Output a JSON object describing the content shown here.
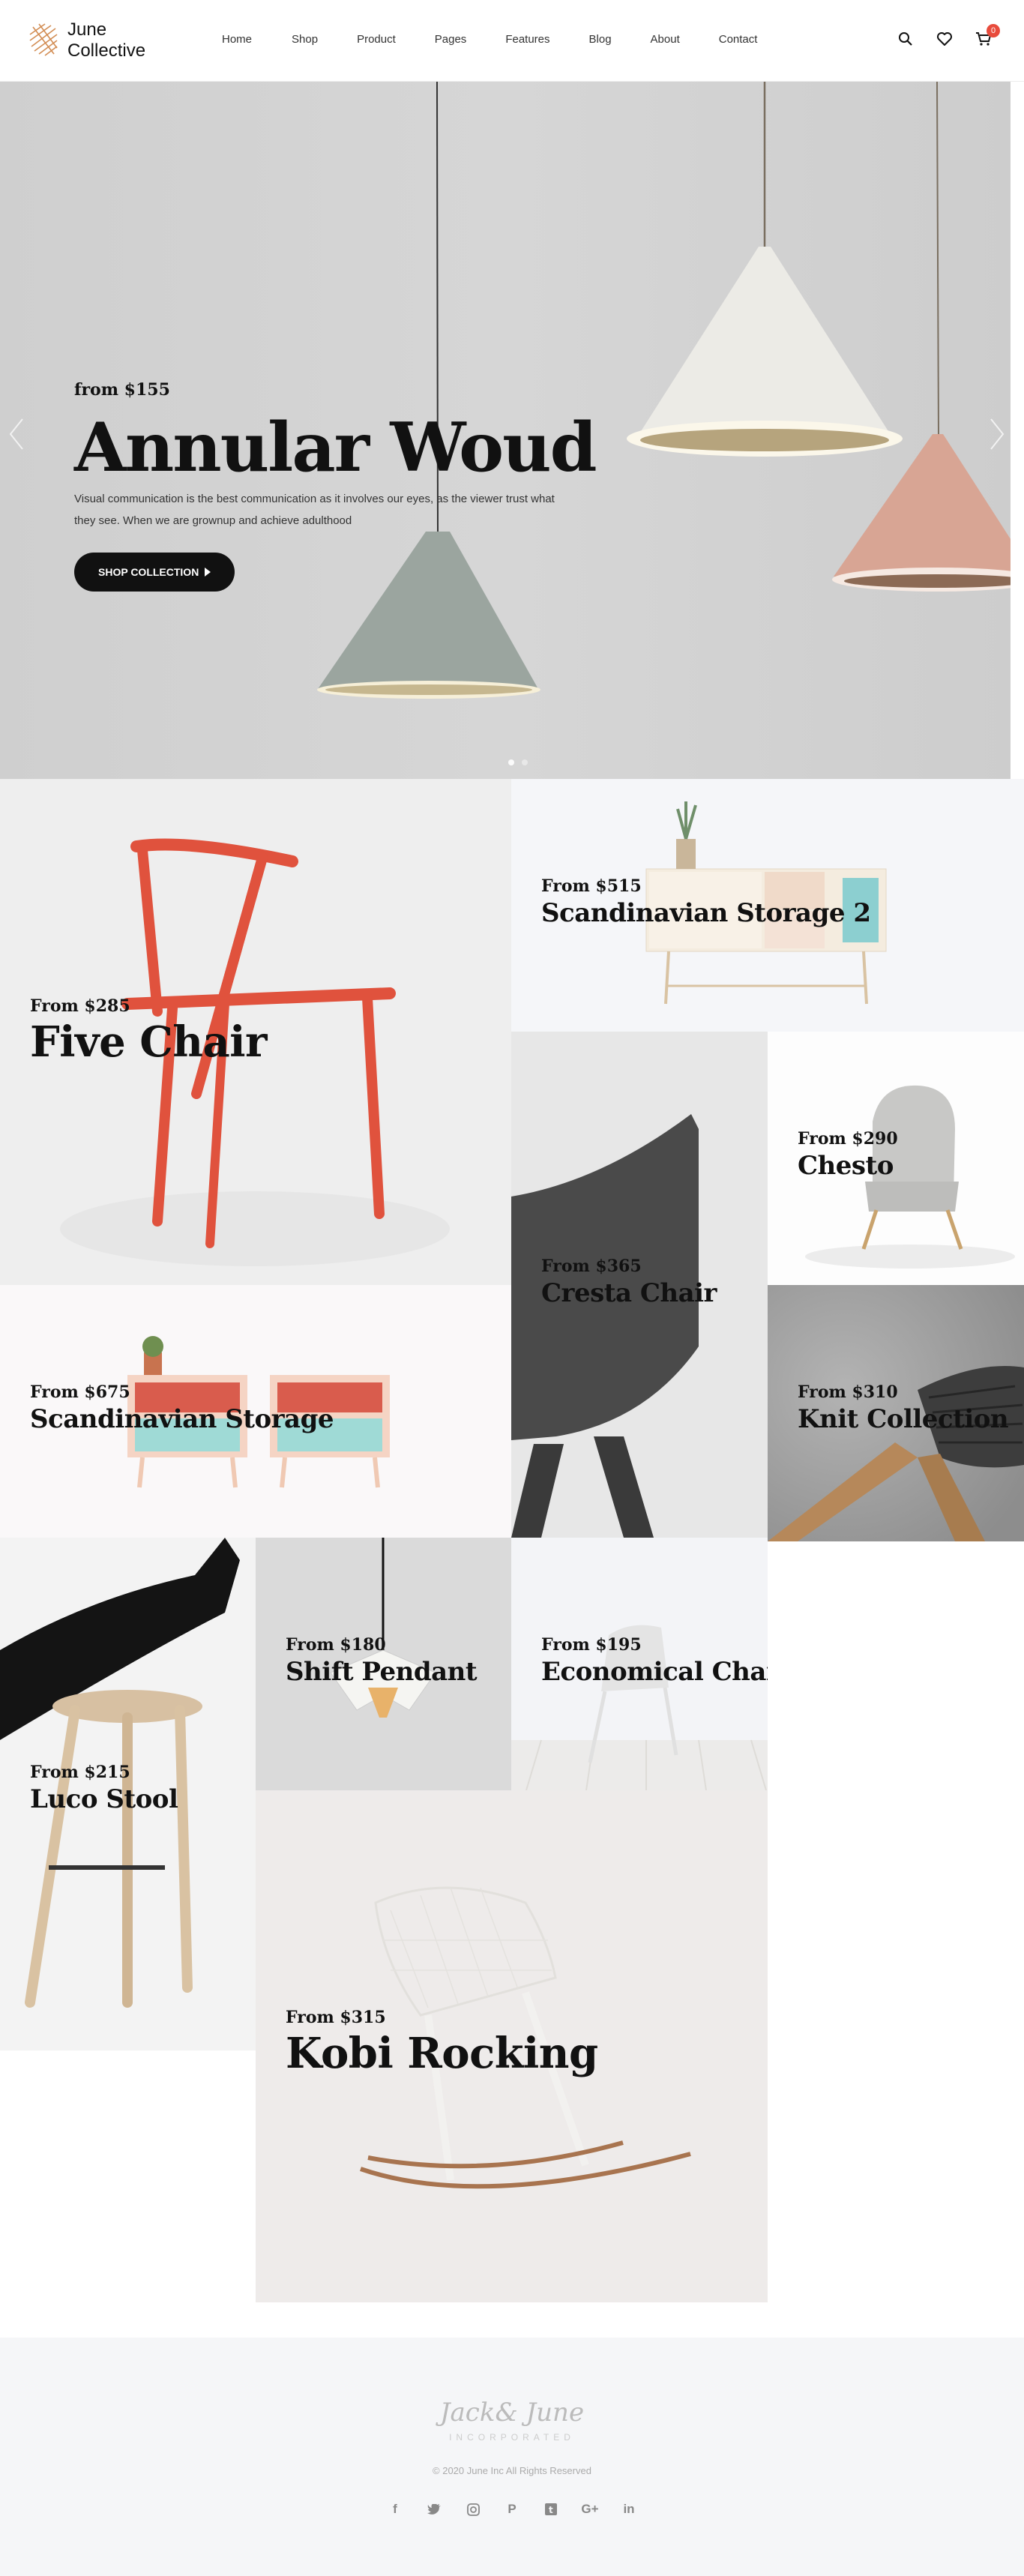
{
  "header": {
    "logo_line1": "June",
    "logo_line2": "Collective",
    "nav": [
      "Home",
      "Shop",
      "Product",
      "Pages",
      "Features",
      "Blog",
      "About",
      "Contact"
    ],
    "cart_count": "0"
  },
  "hero": {
    "price": "from $155",
    "title": "Annular Woud",
    "description": "Visual communication is the best communication as it involves our eyes, as the viewer trust what they see. When we are grownup and achieve adulthood",
    "button": "SHOP COLLECTION"
  },
  "products": {
    "five_chair": {
      "price": "From $285",
      "title": "Five Chair"
    },
    "scandi_storage_2": {
      "price": "From $515",
      "title": "Scandinavian Storage 2"
    },
    "chesto": {
      "price": "From $290",
      "title": "Chesto"
    },
    "cresta": {
      "price": "From $365",
      "title": "Cresta Chair"
    },
    "scandi_storage": {
      "price": "From $675",
      "title": "Scandinavian Storage"
    },
    "knit": {
      "price": "From $310",
      "title": "Knit Collection"
    },
    "luco": {
      "price": "From $215",
      "title": "Luco Stool"
    },
    "shift": {
      "price": "From $180",
      "title": "Shift Pendant"
    },
    "economical": {
      "price": "From $195",
      "title": "Economical Chair"
    },
    "kobi": {
      "price": "From $315",
      "title": "Kobi Rocking"
    }
  },
  "footer": {
    "brand": "Jack& June",
    "brand_sub": "INCORPORATED",
    "copyright": "© 2020 June Inc All Rights Reserved",
    "socials": [
      "facebook-icon",
      "twitter-icon",
      "instagram-icon",
      "pinterest-icon",
      "tumblr-icon",
      "google-plus-icon",
      "linkedin-icon"
    ]
  },
  "colors": {
    "accent": "#e84b3c",
    "chair_red": "#e0523d",
    "footer_bg": "#f5f6f8"
  }
}
